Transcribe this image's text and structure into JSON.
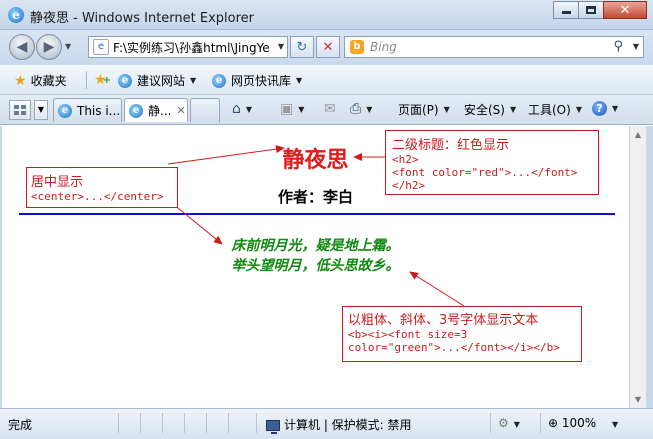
{
  "window": {
    "title": "静夜思 - Windows Internet Explorer",
    "app_icon": "ie-icon"
  },
  "toolbar": {
    "address": "F:\\实例练习\\孙鑫html\\JingYe",
    "search_placeholder": "Bing"
  },
  "favorites": {
    "label": "收藏夹",
    "items": [
      {
        "label": "建议网站"
      },
      {
        "label": "网页快讯库"
      }
    ]
  },
  "tabs": [
    {
      "label": "This i...",
      "active": false
    },
    {
      "label": "静...",
      "active": true
    }
  ],
  "commands": {
    "page": "页面(P)",
    "safety": "安全(S)",
    "tools": "工具(O)"
  },
  "page": {
    "title": "静夜思",
    "author": "作者：李白",
    "poem_lines": [
      "床前明月光，疑是地上霜。",
      "举头望明月，低头思故乡。"
    ],
    "title_color": "#e11a1a",
    "poem_color": "#0f8a0f",
    "rule_color": "#1010c8"
  },
  "annotations": {
    "heading_note": {
      "heading": "二级标题：红色显示",
      "code": [
        "<h2>",
        "<font color=\"red\">...</font>",
        "</h2>"
      ]
    },
    "center_note": {
      "heading": "居中显示",
      "code": [
        "<center>...</center>"
      ]
    },
    "text_note": {
      "heading": "以粗体、斜体、3号字体显示文本",
      "code": [
        "<b><i><font size=3",
        "color=\"green\">...</font></i></b>"
      ]
    }
  },
  "status": {
    "text": "完成",
    "zone": "计算机 | 保护模式: 禁用",
    "zoom": "100%"
  }
}
